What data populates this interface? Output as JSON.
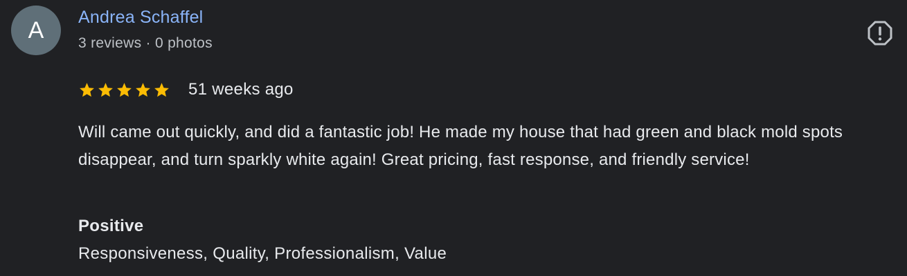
{
  "author": {
    "avatar_letter": "A",
    "name": "Andrea Schaffel",
    "meta": "3 reviews · 0 photos"
  },
  "icons": {
    "report": "report-flag-icon",
    "star": "star-icon"
  },
  "rating": {
    "stars": 5,
    "max_stars": 5,
    "time_ago": "51 weeks ago"
  },
  "review": {
    "text": "Will came out quickly, and did a fantastic job! He made my house that had green and black mold spots disappear, and turn sparkly white again! Great pricing, fast response, and friendly service!"
  },
  "aspects": {
    "heading": "Positive",
    "values": "Responsiveness, Quality, Professionalism, Value"
  },
  "colors": {
    "background": "#202124",
    "author_link": "#8ab4f8",
    "star": "#fbbc04",
    "text": "#e8eaed",
    "muted": "#bdc1c6",
    "avatar_bg": "#5f6f78"
  }
}
